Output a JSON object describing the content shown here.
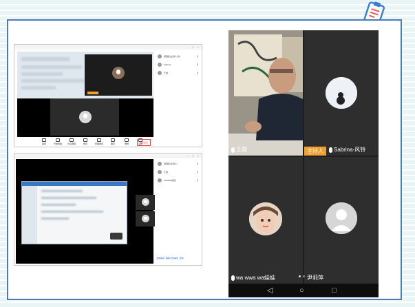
{
  "theme": {
    "frame_border": "#4d7bb3",
    "host_badge": "#f0a030",
    "end_button": "#e04a4a"
  },
  "top_screenshot": {
    "participants": [
      {
        "name": "郑国和(主持人,我)",
        "icon": "mic-icon"
      },
      {
        "name": "Sabrina",
        "icon": "mic-icon"
      },
      {
        "name": "王霖",
        "icon": "mic-icon"
      }
    ],
    "toolbar": [
      {
        "label": "静音",
        "icon": "mic-icon"
      },
      {
        "label": "开启视频",
        "icon": "camera-icon"
      },
      {
        "label": "共享屏幕",
        "icon": "share-icon"
      },
      {
        "label": "成员",
        "icon": "people-icon"
      },
      {
        "label": "管理成员",
        "icon": "manage-icon"
      },
      {
        "label": "聊天",
        "icon": "chat-icon"
      },
      {
        "label": "录制",
        "icon": "record-icon"
      },
      {
        "label": "设置",
        "icon": "gear-icon"
      }
    ],
    "end_label": "结束会议"
  },
  "bottom_screenshot": {
    "participants": [
      {
        "name": "郑国和(主持人)",
        "icon": "mic-icon"
      },
      {
        "name": "王霖",
        "icon": "mic-icon"
      },
      {
        "name": "wawawa娃娃",
        "icon": "mic-icon"
      }
    ],
    "footer_buttons": [
      "全体静音",
      "解除全体静音",
      "更多"
    ]
  },
  "phone": {
    "tiles": [
      {
        "name": "王霖",
        "host": false
      },
      {
        "name": "Sabrina-风铃",
        "host": true,
        "host_label": "主持人"
      },
      {
        "name": "wa wwa wa娃娃",
        "host": false
      },
      {
        "name": "尹莉萍",
        "host": false
      }
    ],
    "navbar": {
      "back": "◁",
      "home": "○",
      "recents": "□"
    }
  }
}
